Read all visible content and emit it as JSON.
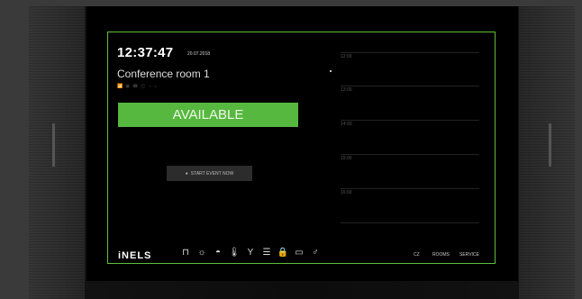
{
  "clock": {
    "time": "12:37:47",
    "date": "20.07.2018"
  },
  "room": {
    "name": "Conference room 1",
    "equipment": [
      "📶",
      "▣",
      "☎",
      "◫",
      "☼",
      "⌂"
    ]
  },
  "status": {
    "label": "AVAILABLE",
    "color": "#57b83f"
  },
  "action": {
    "label": "START EVENT NOW",
    "icon": "record-icon"
  },
  "timeline": {
    "hours": [
      "12:00",
      "13:00",
      "14:00",
      "15:00",
      "16:00",
      ""
    ]
  },
  "brand": {
    "logo": "iNELS"
  },
  "toolbar": {
    "icons": [
      "table-icon",
      "light-bulb-icon",
      "ceiling-light-icon",
      "thermometer-icon",
      "cocktail-icon",
      "blinds-icon",
      "lock-icon",
      "projector-icon",
      "air-icon"
    ],
    "glyphs": [
      "⊓",
      "☼",
      "◓",
      "🌡",
      "Y",
      "☰",
      "🔒",
      "▭",
      "♂"
    ]
  },
  "nav": {
    "cz": "CZ",
    "rooms": "ROOMS",
    "service": "SERVICE"
  },
  "theme": {
    "accent": "#57b83f",
    "frame": "#5fbf3a"
  }
}
